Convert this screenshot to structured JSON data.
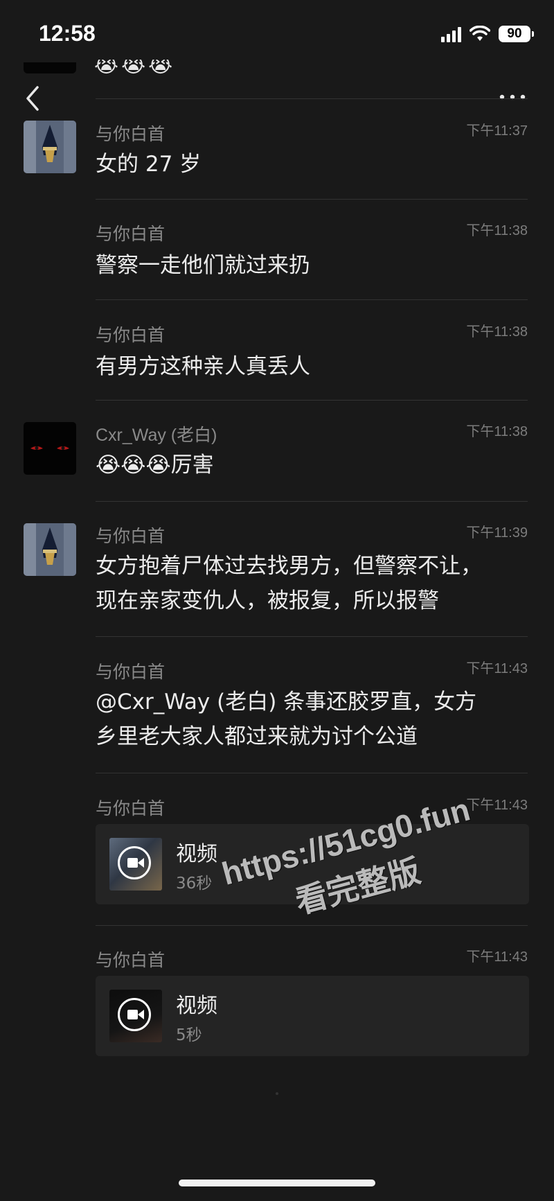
{
  "status_bar": {
    "time": "12:58",
    "battery": "90"
  },
  "previous_message": {
    "emojis": [
      "😭",
      "😭",
      "😭"
    ]
  },
  "messages": [
    {
      "sender": "与你白首",
      "time": "下午11:37",
      "text": "女的 27 岁"
    },
    {
      "sender": "与你白首",
      "time": "下午11:38",
      "text": "警察一走他们就过来扔"
    },
    {
      "sender": "与你白首",
      "time": "下午11:38",
      "text": "有男方这种亲人真丢人"
    },
    {
      "sender": "Cxr_Way (老白)",
      "time": "下午11:38",
      "text": "😭😭😭厉害"
    },
    {
      "sender": "与你白首",
      "time": "下午11:39",
      "text_line1": "女方抱着尸体过去找男方，但警察不让，",
      "text_line2": "现在亲家变仇人，被报复，所以报警"
    },
    {
      "sender": "与你白首",
      "time": "下午11:43",
      "text_line1": "@Cxr_Way (老白) 条事还胶罗直，女方",
      "text_line2": "乡里老大家人都过来就为讨个公道"
    },
    {
      "sender": "与你白首",
      "time": "下午11:43",
      "video_title": "视频",
      "video_duration": "36秒"
    },
    {
      "sender": "与你白首",
      "time": "下午11:43",
      "video_title": "视频",
      "video_duration": "5秒"
    }
  ],
  "watermark": {
    "line1": "https://51cg0.fun",
    "line2": "看完整版"
  },
  "colors": {
    "background": "#191919",
    "text": "#ececec",
    "secondary": "#8a8a8a"
  }
}
